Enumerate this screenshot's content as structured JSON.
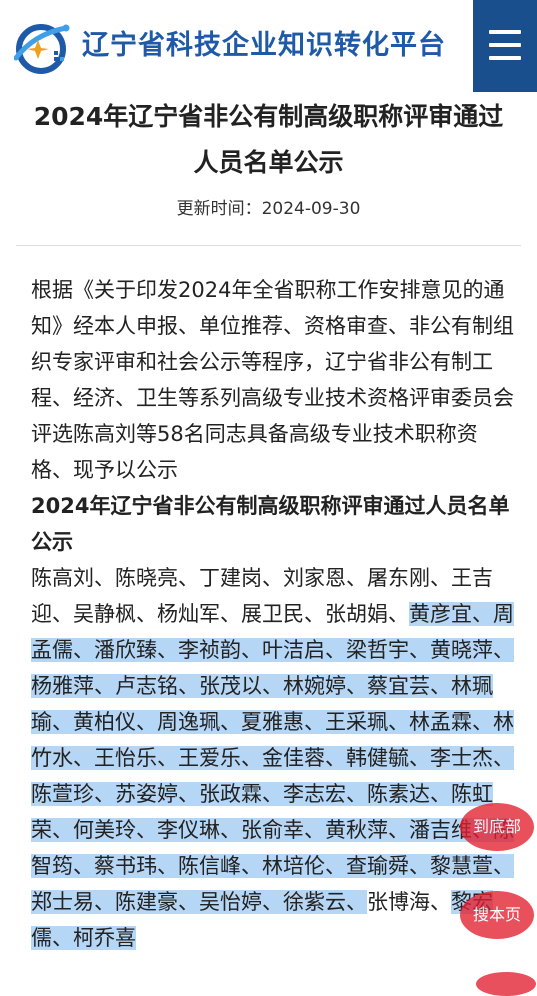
{
  "header": {
    "site_title": "辽宁省科技企业知识转化平台",
    "menu_icon": "menu-icon",
    "brand_color": "#1f5aa8",
    "menu_bg": "#1a4f8e"
  },
  "article": {
    "title_line1": "2024年辽宁省非公有制高级职称评审通过",
    "title_line2": "人员名单公示",
    "update_label": "更新时间：",
    "update_date": "2024-09-30",
    "intro": "根据《关于印发2024年全省职称工作安排意见的通知》经本人申报、单位推荐、资格审查、非公有制组织专家评审和社会公示等程序，辽宁省非公有制工程、经济、卫生等系列高级专业技术资格评审委员会评选陈高刘等58名同志具备高级专业技术职称资格、现予以公示",
    "list_heading": "2024年辽宁省非公有制高级职称评审通过人员名单公示",
    "names_plain": "陈高刘、陈晓亮、丁建岗、刘家恩、屠东刚、王吉迎、吴静枫、杨灿军、展卫民、张胡娟、",
    "names_highlighted": "黄彦宜、周孟儒、潘欣臻、李祯韵、叶洁启、梁哲宇、黄晓萍、杨雅萍、卢志铭、张茂以、林婉婷、蔡宜芸、林珮瑜、黄柏仪、周逸珮、夏雅惠、王采珮、林孟霖、林竹水、王怡乐、王爱乐、金佳蓉、韩健毓、李士杰、陈萱珍、苏姿婷、张政霖、李志宏、陈素达、陈虹荣、何美玲、李仪琳、张俞幸、黄秋萍、潘吉维、陈智筠、蔡书玮、陈信峰、林培伦、查瑜舜、黎慧萱、郑士易、陈建豪、吴怡婷、徐紫云、",
    "names_tail_plain": "张博海、",
    "names_tail_highlighted": "黎宏儒、柯乔喜"
  },
  "float_buttons": {
    "to_bottom": "到底部",
    "search_page": "搜本页",
    "color": "#e21f2f"
  },
  "highlight_color": "#b6d6f5"
}
